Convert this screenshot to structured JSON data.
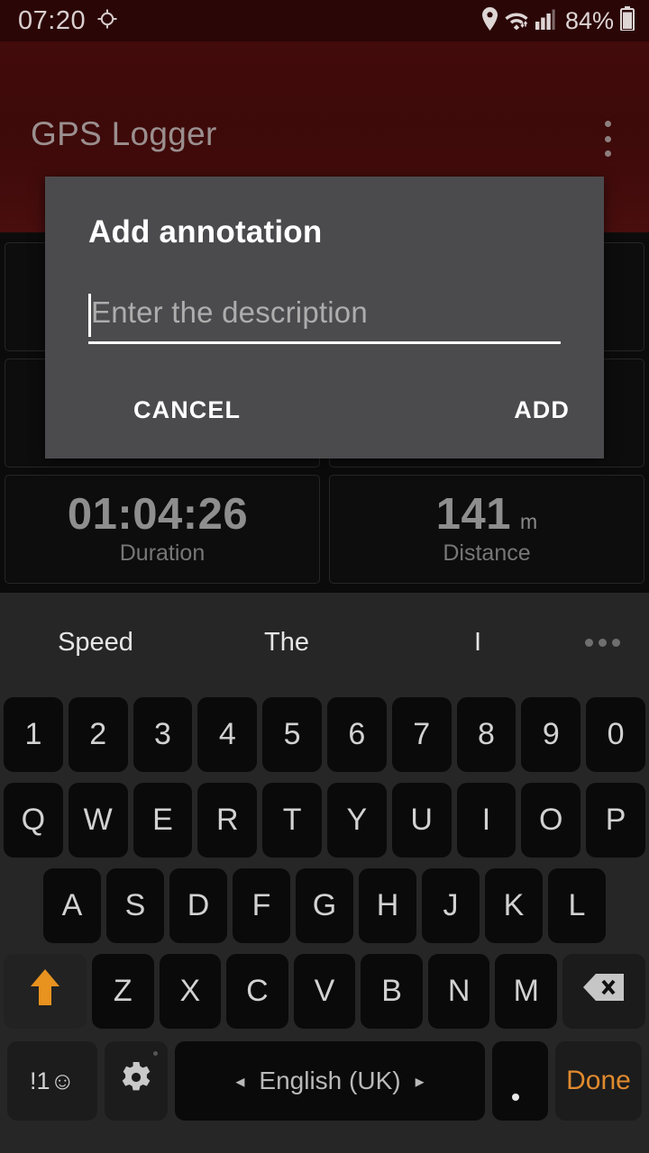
{
  "status_bar": {
    "time": "07:20",
    "gps_icon": "gps-crosshair-icon",
    "location_icon": "location-pin-icon",
    "wifi_icon": "wifi-icon",
    "signal_icon": "cellular-signal-icon",
    "battery_percent": "84%",
    "battery_icon": "battery-icon"
  },
  "app_bar": {
    "title": "GPS Logger",
    "overflow_icon": "overflow-menu-icon",
    "background_color": "#3d0909"
  },
  "stats": {
    "cards": [
      {
        "value": "",
        "unit": "",
        "label": ""
      },
      {
        "value": "",
        "unit": "",
        "label": ""
      },
      {
        "value": "",
        "unit": "",
        "label": ""
      },
      {
        "value": "",
        "unit": "",
        "label": ""
      },
      {
        "value": "01:04:26",
        "unit": "",
        "label": "Duration"
      },
      {
        "value": "141",
        "unit": "m",
        "label": "Distance"
      }
    ]
  },
  "dialog": {
    "title": "Add annotation",
    "input_value": "",
    "input_placeholder": "Enter the description",
    "cancel_label": "CANCEL",
    "add_label": "ADD",
    "background_color": "#4b4b4e"
  },
  "keyboard": {
    "suggestions": [
      "Speed",
      "The",
      "I"
    ],
    "more_icon": "more-suggestions-icon",
    "rows": {
      "numbers": [
        "1",
        "2",
        "3",
        "4",
        "5",
        "6",
        "7",
        "8",
        "9",
        "0"
      ],
      "top": [
        "Q",
        "W",
        "E",
        "R",
        "T",
        "Y",
        "U",
        "I",
        "O",
        "P"
      ],
      "home": [
        "A",
        "S",
        "D",
        "F",
        "G",
        "H",
        "J",
        "K",
        "L"
      ],
      "bottom": [
        "Z",
        "X",
        "C",
        "V",
        "B",
        "N",
        "M"
      ]
    },
    "shift_icon": "shift-up-arrow-icon",
    "shift_color": "#e8921f",
    "backspace_icon": "backspace-icon",
    "symbols_label": "!1☺",
    "settings_icon": "gear-icon",
    "space_label": "English (UK)",
    "space_prev_icon": "◂",
    "space_next_icon": "▸",
    "period_label": ".",
    "done_label": "Done",
    "done_color": "#e08a2e"
  }
}
